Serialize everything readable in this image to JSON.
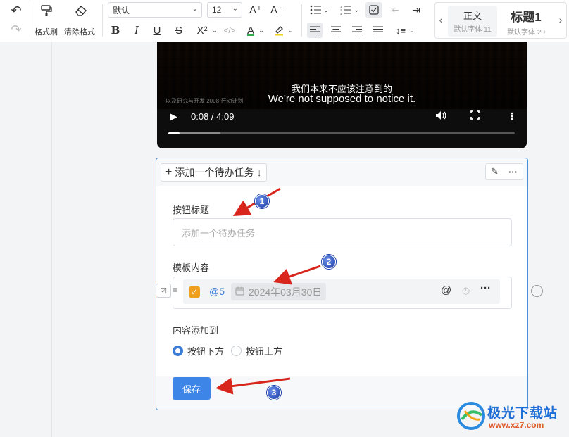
{
  "toolbar": {
    "brush_label": "格式刷",
    "clear_label": "清除格式",
    "font_family": "默认",
    "font_size": "12",
    "bold": "B",
    "italic": "I",
    "underline": "U",
    "strike": "S",
    "superscript": "X²",
    "font_color_glyph": "A",
    "style_prev": "‹",
    "style_next": "›",
    "styles": [
      {
        "name": "正文",
        "sub": "默认字体 11"
      },
      {
        "name": "标题1",
        "sub": "默认字体 20"
      }
    ]
  },
  "video": {
    "subtitle_cn": "我们本来不应该注意到的",
    "subtitle_en": "We're not supposed to notice it.",
    "corner_text": "以及研究与开发 2008 行动计划",
    "time": "0:08 / 4:09",
    "progress": 0.032,
    "buffered": 0.15
  },
  "task": {
    "add_button_label": "添加一个待办任务",
    "button_title_label": "按钮标题",
    "button_title_placeholder": "添加一个待办任务",
    "template_label": "模板内容",
    "mention": "@5",
    "date": "2024年03月30日",
    "add_to_label": "内容添加到",
    "options": [
      "按钮下方",
      "按钮上方"
    ],
    "selected_option": "按钮下方",
    "save_label": "保存"
  },
  "annotations": [
    "1",
    "2",
    "3"
  ],
  "site": {
    "name": "极光下载站",
    "url": "www.xz7.com"
  },
  "colors": {
    "accent": "#3d86e8",
    "task_border": "#4a90d9",
    "checkbox": "#f0a020",
    "arrow": "#d9261c"
  }
}
